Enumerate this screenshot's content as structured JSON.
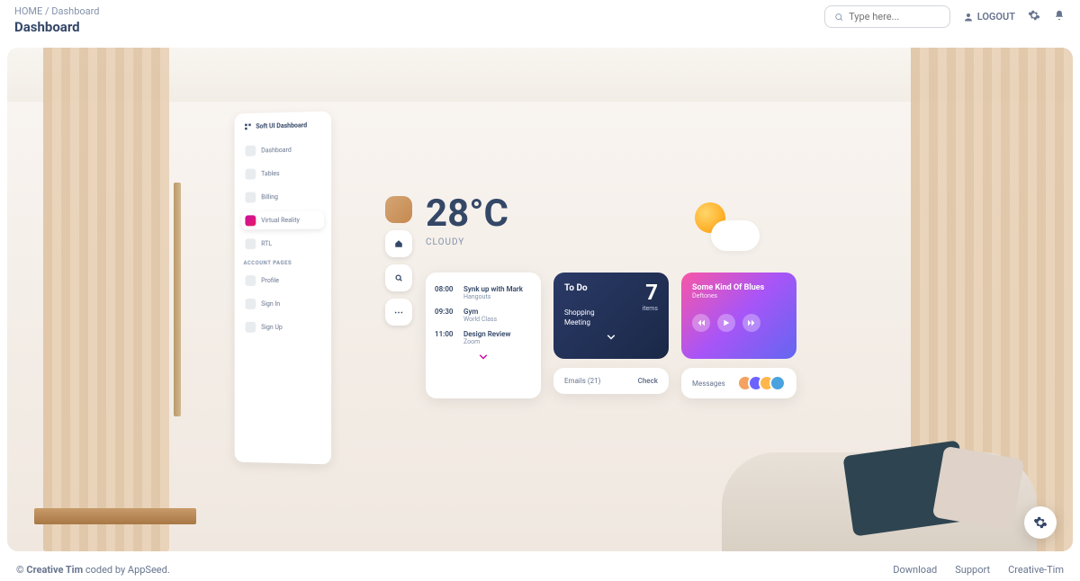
{
  "breadcrumb": {
    "home": "HOME",
    "current": "Dashboard"
  },
  "page_title": "Dashboard",
  "search": {
    "placeholder": "Type here..."
  },
  "logout": "LOGOUT",
  "sidebar": {
    "brand": "Soft UI Dashboard",
    "items": [
      {
        "label": "Dashboard"
      },
      {
        "label": "Tables"
      },
      {
        "label": "Billing"
      },
      {
        "label": "Virtual Reality"
      },
      {
        "label": "RTL"
      }
    ],
    "section": "ACCOUNT PAGES",
    "account_items": [
      {
        "label": "Profile"
      },
      {
        "label": "Sign In"
      },
      {
        "label": "Sign Up"
      }
    ]
  },
  "weather": {
    "temp": "28°C",
    "condition": "CLOUDY"
  },
  "schedule": [
    {
      "time": "08:00",
      "title": "Synk up with Mark",
      "sub": "Hangouts"
    },
    {
      "time": "09:30",
      "title": "Gym",
      "sub": "World Class"
    },
    {
      "time": "11:00",
      "title": "Design Review",
      "sub": "Zoom"
    }
  ],
  "todo": {
    "title": "To Do",
    "count": "7",
    "items_label": "items",
    "list": [
      "Shopping",
      "Meeting"
    ]
  },
  "emails": {
    "label": "Emails (21)",
    "action": "Check"
  },
  "music": {
    "title": "Some Kind Of Blues",
    "artist": "Deftones"
  },
  "messages": {
    "label": "Messages"
  },
  "footer": {
    "copyright_prefix": "© ",
    "brand": "Creative Tim",
    "suffix": " coded by AppSeed.",
    "links": [
      "Download",
      "Support",
      "Creative-Tim"
    ]
  }
}
